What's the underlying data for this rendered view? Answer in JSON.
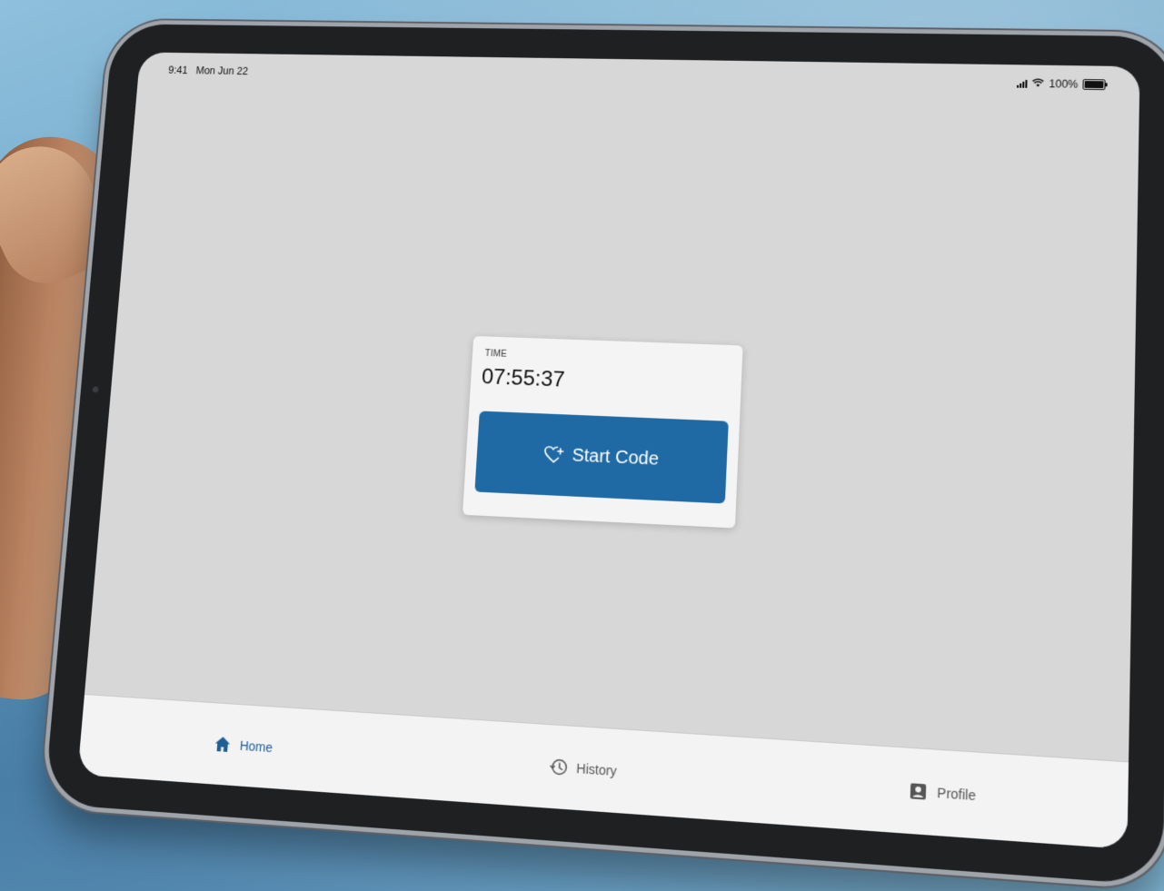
{
  "status_bar": {
    "time": "9:41",
    "date": "Mon Jun 22",
    "battery": "100%"
  },
  "card": {
    "label": "TIME",
    "time_value": "07:55:37",
    "button_label": "Start Code",
    "button_icon": "heart-plus-icon"
  },
  "tab_bar": {
    "tabs": [
      {
        "label": "Home",
        "icon": "home-icon",
        "active": true
      },
      {
        "label": "History",
        "icon": "history-icon",
        "active": false
      },
      {
        "label": "Profile",
        "icon": "profile-icon",
        "active": false
      }
    ]
  },
  "colors": {
    "accent": "#1f6aa5",
    "active_tab": "#1f5e96",
    "screen_bg": "#d7d7d7",
    "card_bg": "#f4f4f4"
  }
}
